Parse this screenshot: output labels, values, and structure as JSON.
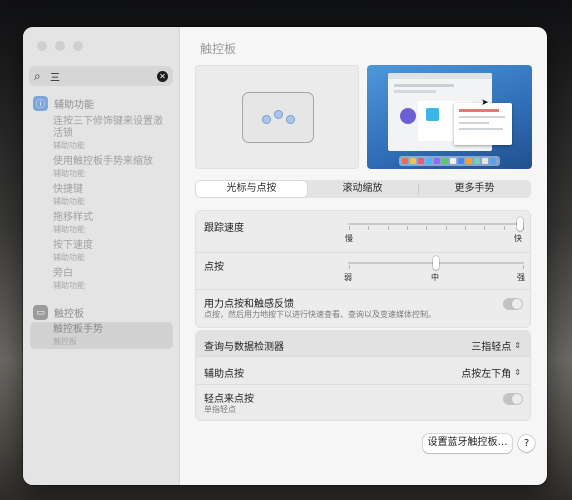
{
  "sidebar": {
    "search_value": "三",
    "sections": [
      {
        "label": "辅助功能",
        "icon": "accessibility-icon",
        "items": [
          {
            "title": "连按三下修饰键来设置激活锁",
            "subtitle": "辅助功能"
          },
          {
            "title": "使用触控板手势来缩放",
            "subtitle": "辅助功能"
          },
          {
            "title": "快捷键",
            "subtitle": "辅助功能"
          },
          {
            "title": "拖移样式",
            "subtitle": "辅助功能"
          },
          {
            "title": "按下速度",
            "subtitle": "辅助功能"
          },
          {
            "title": "旁白",
            "subtitle": "辅助功能"
          }
        ]
      },
      {
        "label": "触控板",
        "icon": "trackpad-icon",
        "items": [
          {
            "title": "触控板手势",
            "subtitle": "触控板"
          }
        ]
      }
    ]
  },
  "main": {
    "title": "触控板",
    "tabs": [
      "光标与点按",
      "滚动缩放",
      "更多手势"
    ],
    "active_tab": 0,
    "tracking_speed": {
      "label": "跟踪速度",
      "min_label": "慢",
      "max_label": "快",
      "value": 1.0
    },
    "click": {
      "label": "点按",
      "labels": [
        "弱",
        "中",
        "强"
      ],
      "value": 0.5
    },
    "force_click": {
      "label": "用力点按和触感反馈",
      "subtitle": "点按，然后用力地按下以进行快速查看、查询以及变速媒体控制。"
    },
    "lookup": {
      "label": "查询与数据检测器",
      "value": "三指轻点"
    },
    "secondary_click": {
      "label": "辅助点按",
      "value": "点按左下角"
    },
    "tap_to_click": {
      "label": "轻点来点按",
      "subtitle": "单指轻点"
    },
    "bluetooth_button": "设置蓝牙触控板…",
    "help_button": "?"
  },
  "colors": {
    "accent": "#3b82f6",
    "toggle_off": "#c3c3c3"
  }
}
